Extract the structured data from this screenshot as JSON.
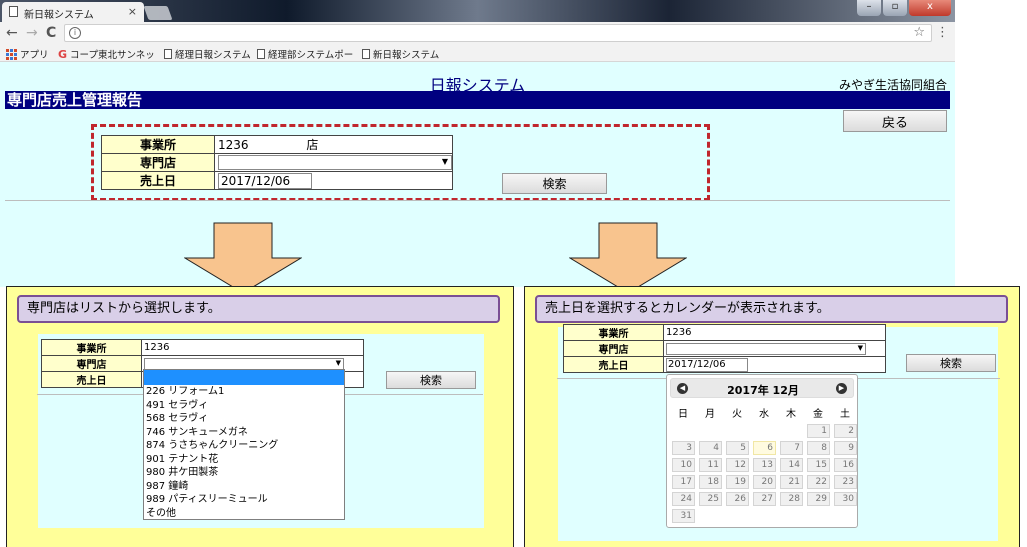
{
  "browser": {
    "tab_title": "新日報システム",
    "tab_close": "×",
    "window_buttons": [
      "–",
      "▫",
      "x"
    ],
    "nav_back": "←",
    "nav_forward": "→",
    "nav_reload": "C",
    "bookmarks": [
      "アプリ",
      "コープ東北サンネッ",
      "経理日報システム",
      "経理部システムポー",
      "新日報システム"
    ]
  },
  "page": {
    "app_title": "日報システム",
    "org_name": "みやぎ生活協同組合",
    "header": "専門店売上管理報告",
    "back_label": "戻る",
    "form": {
      "office_label": "事業所",
      "office_value": "1236",
      "office_suffix": "店",
      "shop_label": "専門店",
      "shop_value": "",
      "date_label": "売上日",
      "date_value": "2017/12/06"
    },
    "search_label": "検索"
  },
  "left_panel": {
    "callout": "専門店はリストから選択します。",
    "form": {
      "office_label": "事業所",
      "office_value": "1236",
      "shop_label": "専門店",
      "date_label": "売上日"
    },
    "search_label": "検索",
    "options": [
      "",
      "226 リフォーム1",
      "491 セラヴィ",
      "568 セラヴィ",
      "746 サンキューメガネ",
      "874 うさちゃんクリーニング",
      "901 テナント花",
      "980 井ケ田製茶",
      "987 鐘崎",
      "989 パティスリーミュール",
      "その他"
    ]
  },
  "right_panel": {
    "callout": "売上日を選択するとカレンダーが表示されます。",
    "form": {
      "office_label": "事業所",
      "office_value": "1236",
      "shop_label": "専門店",
      "date_label": "売上日",
      "date_value": "2017/12/06"
    },
    "search_label": "検索",
    "calendar": {
      "title": "2017年 12月",
      "weekdays": [
        "日",
        "月",
        "火",
        "水",
        "木",
        "金",
        "土"
      ],
      "weeks": [
        [
          "",
          "",
          "",
          "",
          "",
          "1",
          "2"
        ],
        [
          "3",
          "4",
          "5",
          "6",
          "7",
          "8",
          "9"
        ],
        [
          "10",
          "11",
          "12",
          "13",
          "14",
          "15",
          "16"
        ],
        [
          "17",
          "18",
          "19",
          "20",
          "21",
          "22",
          "23"
        ],
        [
          "24",
          "25",
          "26",
          "27",
          "28",
          "29",
          "30"
        ],
        [
          "31",
          "",
          "",
          "",
          "",
          "",
          ""
        ]
      ],
      "highlight_day": "6"
    }
  },
  "colors": {
    "page_bg": "#e0ffff",
    "header_bg": "#000080",
    "label_bg": "#ffffcc",
    "dashed_border": "#c0262d",
    "panel_bg": "#ffff99",
    "callout_bg": "#d9cfe8",
    "callout_border": "#7a4f94",
    "arrow_fill": "#f8c48e",
    "dropdown_selected": "#1e90ff"
  }
}
